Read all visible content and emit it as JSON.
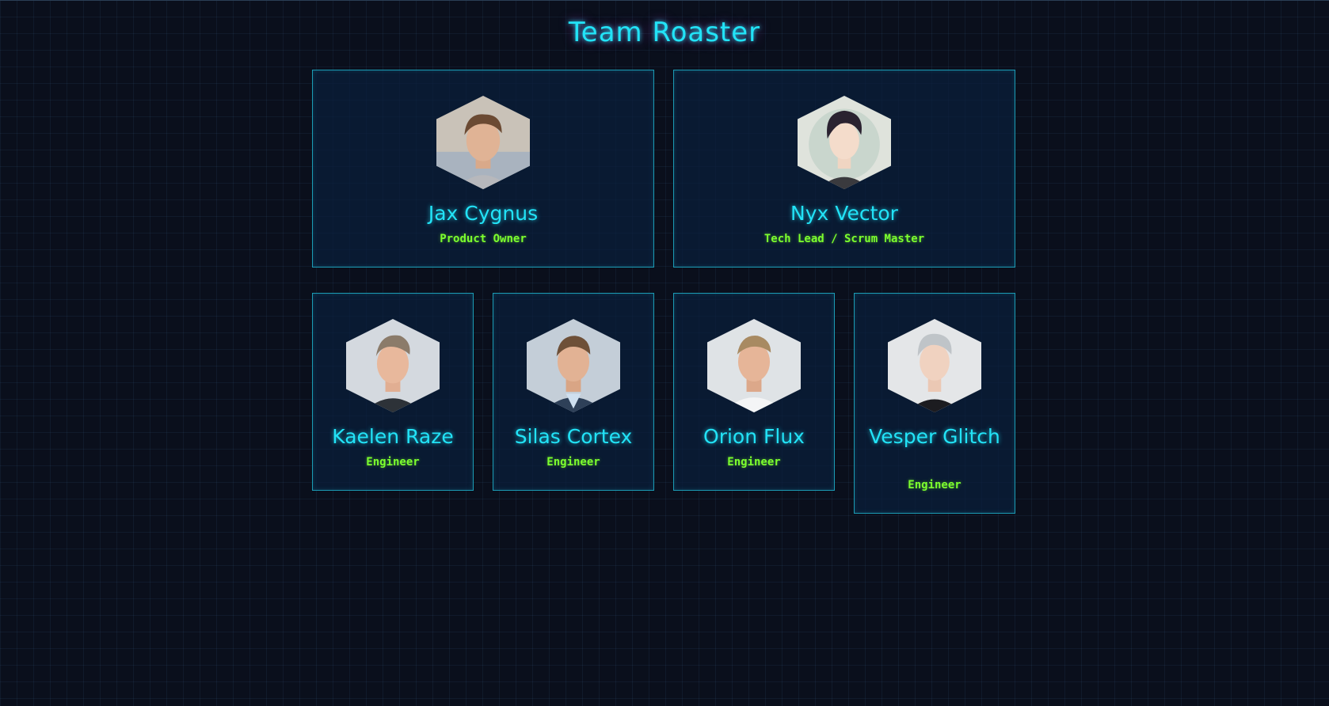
{
  "page": {
    "title": "Team Roaster"
  },
  "colors": {
    "background": "#0a0f1c",
    "accent_cyan": "#22e3f7",
    "role_green": "#7cff2e",
    "card_border": "#1b9bb4"
  },
  "members": [
    {
      "name": "Jax Cygnus",
      "role": "Product Owner",
      "avatar_icon": "avatar-photo-icon"
    },
    {
      "name": "Nyx Vector",
      "role": "Tech Lead / Scrum Master",
      "avatar_icon": "avatar-illustration-icon"
    },
    {
      "name": "Kaelen Raze",
      "role": "Engineer",
      "avatar_icon": "avatar-photo-icon"
    },
    {
      "name": "Silas Cortex",
      "role": "Engineer",
      "avatar_icon": "avatar-photo-icon"
    },
    {
      "name": "Orion Flux",
      "role": "Engineer",
      "avatar_icon": "avatar-photo-icon"
    },
    {
      "name": "Vesper Glitch",
      "role": "Engineer",
      "avatar_icon": "avatar-photo-icon"
    }
  ]
}
